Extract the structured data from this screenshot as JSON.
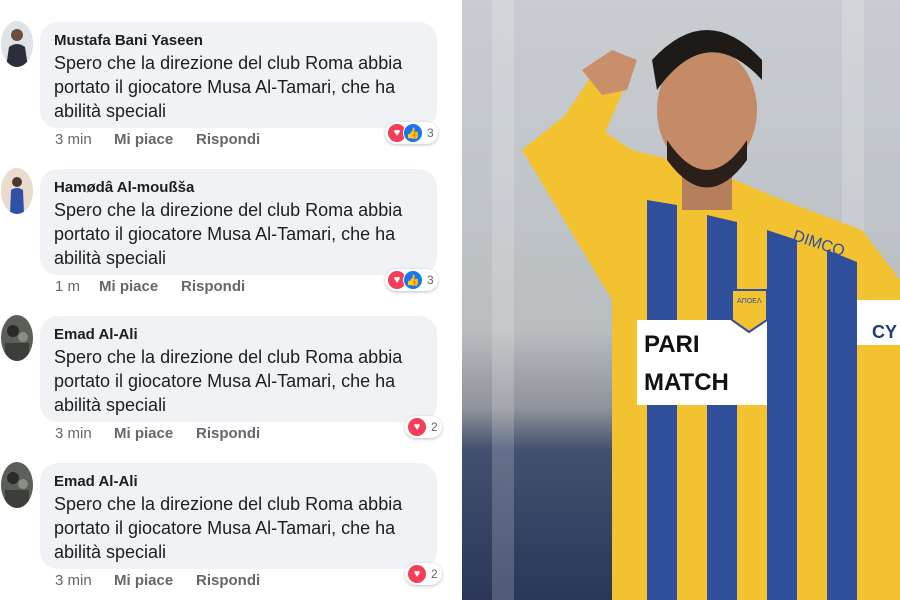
{
  "comments": [
    {
      "author": "Mustafa Bani Yaseen",
      "lines": [
        "Spero che la direzione del club Roma abbia",
        "portato il giocatore Musa Al-Tamari, che ha",
        "abilità speciali"
      ],
      "time": "3 min",
      "like": "Mi piace",
      "reply": "Rispondi",
      "reactions": {
        "icons": [
          "heart-icon",
          "thumbs-up-icon"
        ],
        "count": "3"
      }
    },
    {
      "author": "Hamødâ Al-moußša",
      "lines": [
        "Spero che la direzione del club Roma abbia",
        "portato il giocatore Musa Al-Tamari, che ha",
        "abilità speciali"
      ],
      "time": "1 m",
      "like": "Mi piace",
      "reply": "Rispondi",
      "reactions": {
        "icons": [
          "heart-icon",
          "thumbs-up-icon"
        ],
        "count": "3"
      }
    },
    {
      "author": "Emad Al-Ali",
      "lines": [
        "Spero che la direzione del club Roma abbia",
        "portato il giocatore Musa Al-Tamari, che ha",
        "abilità speciali"
      ],
      "time": "3 min",
      "like": "Mi piace",
      "reply": "Rispondi",
      "reactions": {
        "icons": [
          "heart-icon"
        ],
        "count": "2"
      }
    },
    {
      "author": "Emad Al-Ali",
      "lines": [
        "Spero che la direzione del club Roma abbia",
        "portato il giocatore Musa Al-Tamari, che ha",
        "abilità speciali"
      ],
      "time": "3 min",
      "like": "Mi piace",
      "reply": "Rispondi",
      "reactions": {
        "icons": [
          "heart-icon"
        ],
        "count": "2"
      }
    }
  ],
  "photo": {
    "jersey_sponsor_line1": "PARI",
    "jersey_sponsor_line2": "MATCH",
    "jersey_brand": "DIMCO",
    "crest_text": "ΑΠΟΕΛ",
    "sleeve_badge": "CY"
  },
  "colors": {
    "heart": "#f33e58",
    "thumb": "#1877f2",
    "bubble": "#f0f2f5",
    "jersey_yellow": "#f2c230",
    "jersey_blue": "#2f4f9c"
  }
}
